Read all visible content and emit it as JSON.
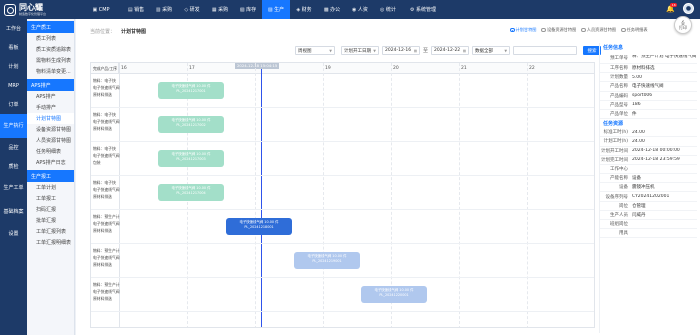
{
  "app": {
    "name": "同心耀",
    "subtitle": "制造数字化管理平台",
    "notifications": "16",
    "print": "打印"
  },
  "topnav": [
    {
      "label": "CMP",
      "icon": "▣"
    },
    {
      "label": "销售",
      "icon": "▤"
    },
    {
      "label": "采购",
      "icon": "▥"
    },
    {
      "label": "研发",
      "icon": "◇"
    },
    {
      "label": "采购",
      "icon": "▦"
    },
    {
      "label": "库存",
      "icon": "▧"
    },
    {
      "label": "生产",
      "icon": "▨",
      "active": true
    },
    {
      "label": "财务",
      "icon": "◈"
    },
    {
      "label": "办公",
      "icon": "▩"
    },
    {
      "label": "人资",
      "icon": "◉"
    },
    {
      "label": "统计",
      "icon": "◎"
    },
    {
      "label": "系统管理",
      "icon": "⚙"
    }
  ],
  "sidebar": [
    "工作台",
    "看板",
    "计划",
    "MRP",
    "订单",
    "生产执行",
    "品控",
    "质检",
    "生产工单",
    "基础档案",
    "设置"
  ],
  "submenu": {
    "groups": [
      {
        "title": "生产质工",
        "items": [
          "质工列表",
          "质工资质追踪表",
          "需物料生成列表",
          "物料清单变更..."
        ]
      },
      {
        "title": "APS排产",
        "items": [
          "APS排产",
          "手动排产",
          "计划甘特图",
          "设备资源甘特图",
          "人员资源甘特图",
          "任务明细表",
          "APS排产日志"
        ]
      },
      {
        "title": "生产报工",
        "items": [
          "工单计划",
          "工单报工",
          "扫码汇报",
          "批单汇报",
          "工单汇报列表",
          "工单汇报明细表"
        ]
      }
    ]
  },
  "breadcrumb": {
    "parent": "当前位置：",
    "current": "计划甘特图"
  },
  "view_modes": [
    "计划甘特图",
    "设备资源甘特图",
    "人员资源甘特图",
    "任务明细表"
  ],
  "filters": {
    "view": "周视图",
    "time_type": "计划开工日期",
    "date_from": "2024-12-16",
    "to": "至",
    "date_to": "2024-12-22",
    "status": "数据全部",
    "search": "",
    "query": "搜索"
  },
  "gantt": {
    "left_header": "完成产品/工序",
    "days": [
      "16",
      "17",
      "18",
      "19",
      "20",
      "21",
      "22"
    ],
    "today_label": "2024-12-18 15:04:15",
    "rows": [
      {
        "lines": [
          "物料：电子快",
          "电子快速线气阀",
          "原材料排选"
        ],
        "bar": {
          "title": "电子快速线气阀 10.00 件",
          "code": "PL_20241217001",
          "color": "green"
        }
      },
      {
        "lines": [
          "物料：电子快",
          "电子快速线气阀",
          "原材料排选"
        ],
        "bar": {
          "title": "电子快速线气阀 10.00 件",
          "code": "PL_20241217002",
          "color": "green"
        }
      },
      {
        "lines": [
          "物料：电子快",
          "电子快速线气阀",
          "包装"
        ],
        "bar": {
          "title": "电子快速线气阀 10.00 件",
          "code": "PL_20241217003",
          "color": "green"
        }
      },
      {
        "lines": [
          "物料：电子快",
          "电子快速线气阀",
          "原材料排选"
        ],
        "bar": {
          "title": "电子快速线气阀 10.00 件",
          "code": "PL_20241217004",
          "color": "green"
        }
      },
      {
        "lines": [
          "物料：预生产计",
          "电子快速线气阀",
          "原材料排选"
        ],
        "bar": {
          "title": "电子快速线气阀 10.00 件",
          "code": "PL_20241218001",
          "color": "blue"
        }
      },
      {
        "lines": [
          "物料：预生产计",
          "电子快速线气阀",
          "原材料排选"
        ],
        "bar": {
          "title": "电子快速线气阀 10.00 件",
          "code": "PL_20241219001",
          "color": "lightblue"
        }
      },
      {
        "lines": [
          "物料：预生产计",
          "电子快速线气阀",
          "原材料排选"
        ],
        "bar": {
          "title": "电子快速线气阀 10.00 件",
          "code": "PL_20241220001",
          "color": "lightblue"
        }
      }
    ]
  },
  "info": {
    "section1": "任务信息",
    "fields1": [
      {
        "k": "预工单号",
        "v": "释：预生产计划 电子快速线气阀"
      },
      {
        "k": "工序名称",
        "v": "原材料排选"
      },
      {
        "k": "计划数量",
        "v": "5.00"
      },
      {
        "k": "产品名称",
        "v": "电子快速线气阀"
      },
      {
        "k": "产品编码",
        "v": "sport006"
      },
      {
        "k": "产品型号",
        "v": "186"
      },
      {
        "k": "产品单位",
        "v": "件"
      }
    ],
    "section2": "任务资源",
    "fields2": [
      {
        "k": "标准工时(h)",
        "v": "24.00"
      },
      {
        "k": "计划工时(h)",
        "v": "24.00"
      },
      {
        "k": "计划开工时间",
        "v": "2024-12-18 00:00:00"
      },
      {
        "k": "计划完工时间",
        "v": "2024-12-18 23:59:59"
      },
      {
        "k": "工作中心",
        "v": ""
      },
      {
        "k": "产能名称",
        "v": "设备"
      },
      {
        "k": "设备",
        "v": "震镜冲压机"
      },
      {
        "k": "设备序列号",
        "v": "CY20241202001"
      },
      {
        "k": "岗位",
        "v": "仓管理"
      },
      {
        "k": "生产人员",
        "v": "闫威丹"
      },
      {
        "k": "班组岗位",
        "v": ""
      },
      {
        "k": "用具",
        "v": ""
      }
    ]
  }
}
